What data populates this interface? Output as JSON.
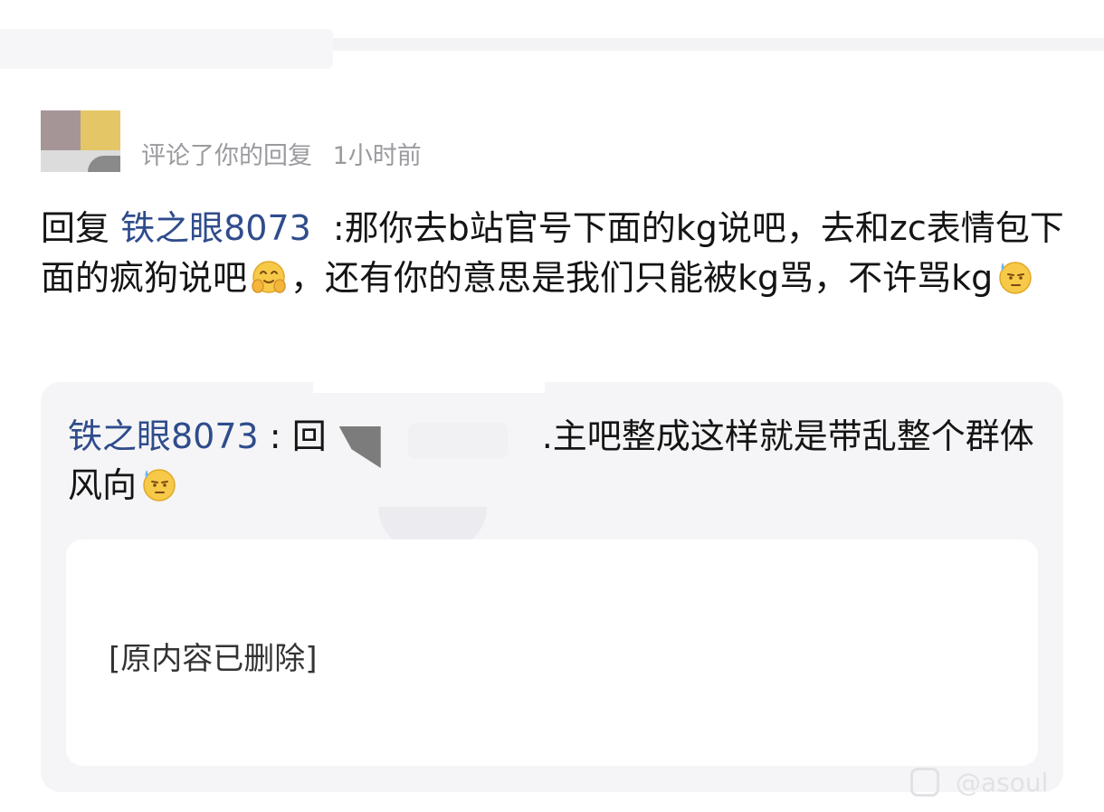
{
  "notification": {
    "action": "评论了你的回复",
    "time": "1小时前"
  },
  "reply": {
    "prefix": "回复",
    "mention": "铁之眼8073",
    "line_a": ":那你去b站官号下面的kg说吧，去和zc表情包下面的疯狗说吧",
    "emoji_a": "smiling-face-with-hands-emoji",
    "line_b": "，还有你的意思是我们只能被kg骂，不许骂kg",
    "emoji_b": "sweat-face-emoji"
  },
  "quoted": {
    "author": "铁之眼8073",
    "separator": " : ",
    "fragment_start": "回",
    "fragment_end": ".主吧整成这样就是带乱整个群体风向",
    "emoji": "sweat-face-emoji",
    "deleted_notice": "[原内容已删除]"
  },
  "watermark": {
    "icon": "app-logo-icon",
    "text": "@asoul"
  },
  "colors": {
    "mention": "#2f4c8c",
    "meta": "#9a9a9f",
    "quote_bg": "#f5f5f7",
    "emoji_yellow": "#f7c948"
  }
}
